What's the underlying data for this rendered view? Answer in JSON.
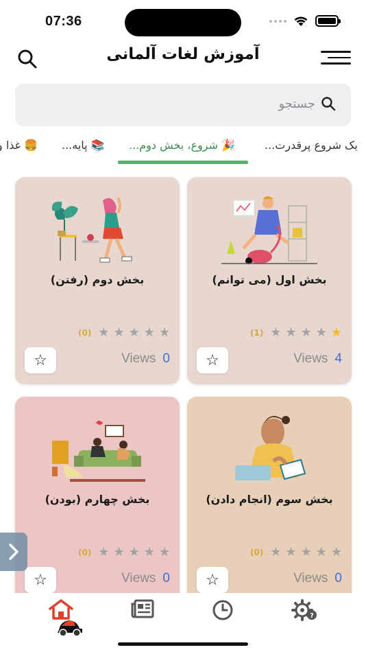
{
  "status": {
    "time": "07:36"
  },
  "header": {
    "title": "آموزش لغات آلمانی"
  },
  "search": {
    "placeholder": "جستجو"
  },
  "categories": [
    {
      "label": "یک شروع پرقدرت..."
    },
    {
      "label": "🎉 شروع، بخش دوم..."
    },
    {
      "label": "📚 پایه..."
    },
    {
      "label": "🍔 غذا و"
    }
  ],
  "cards": [
    {
      "title": "بخش اول (می توانم)",
      "views_label": "Views",
      "views": "4",
      "rating_count": "(1)",
      "stars_filled": 1,
      "bg": "#e8d7cf"
    },
    {
      "title": "بخش دوم (رفتن)",
      "views_label": "Views",
      "views": "0",
      "rating_count": "(0)",
      "stars_filled": 0,
      "bg": "#e8d7cf"
    },
    {
      "title": "بخش سوم (انجام دادن)",
      "views_label": "Views",
      "views": "0",
      "rating_count": "(0)",
      "stars_filled": 0,
      "bg": "#e8cfb8"
    },
    {
      "title": "بخش چهارم (بودن)",
      "views_label": "Views",
      "views": "0",
      "rating_count": "(0)",
      "stars_filled": 0,
      "bg": "#ebc6c4"
    }
  ],
  "tabs": [
    {
      "icon": "home-icon",
      "active": true
    },
    {
      "icon": "news-icon",
      "active": false
    },
    {
      "icon": "history-icon",
      "active": false
    },
    {
      "icon": "settings-icon",
      "active": false
    }
  ],
  "colors": {
    "accent": "#5bb26d",
    "active_tab": "#e0402a",
    "views_number": "#3b6fd4",
    "star_on": "#f5b921"
  }
}
